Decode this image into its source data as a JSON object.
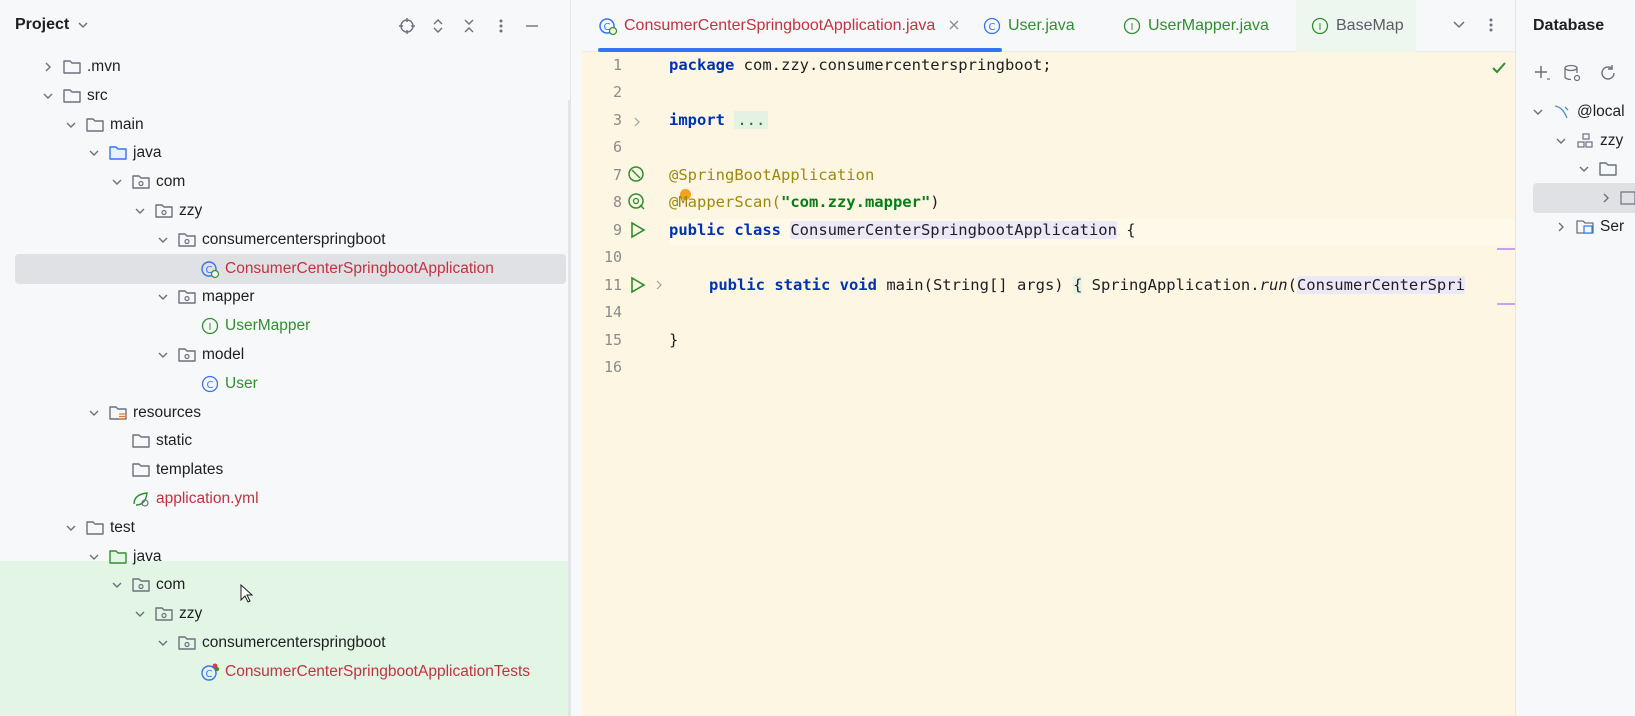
{
  "project": {
    "title": "Project",
    "tree": [
      {
        "label": ".mvn",
        "icon": "folder-icon",
        "expanded": false,
        "level": 0,
        "color": "normal"
      },
      {
        "label": "src",
        "icon": "folder-icon",
        "expanded": true,
        "level": 0,
        "color": "normal"
      },
      {
        "label": "main",
        "icon": "folder-icon",
        "expanded": true,
        "level": 1,
        "color": "normal"
      },
      {
        "label": "java",
        "icon": "source-folder-icon",
        "expanded": true,
        "level": 2,
        "color": "normal"
      },
      {
        "label": "com",
        "icon": "package-icon",
        "expanded": true,
        "level": 3,
        "color": "normal"
      },
      {
        "label": "zzy",
        "icon": "package-icon",
        "expanded": true,
        "level": 4,
        "color": "normal"
      },
      {
        "label": "consumercenterspringboot",
        "icon": "package-icon",
        "expanded": true,
        "level": 5,
        "color": "normal"
      },
      {
        "label": "ConsumerCenterSpringbootApplication",
        "icon": "spring-boot-class-icon",
        "expanded": null,
        "level": 6,
        "color": "red",
        "selected": true
      },
      {
        "label": "mapper",
        "icon": "package-icon",
        "expanded": true,
        "level": 5,
        "color": "normal"
      },
      {
        "label": "UserMapper",
        "icon": "interface-icon",
        "expanded": null,
        "level": 6,
        "color": "green"
      },
      {
        "label": "model",
        "icon": "package-icon",
        "expanded": true,
        "level": 5,
        "color": "normal"
      },
      {
        "label": "User",
        "icon": "class-icon",
        "expanded": null,
        "level": 6,
        "color": "green"
      },
      {
        "label": "resources",
        "icon": "resources-folder-icon",
        "expanded": true,
        "level": 2,
        "color": "normal"
      },
      {
        "label": "static",
        "icon": "folder-icon",
        "expanded": null,
        "level": 3,
        "color": "normal"
      },
      {
        "label": "templates",
        "icon": "folder-icon",
        "expanded": null,
        "level": 3,
        "color": "normal"
      },
      {
        "label": "application.yml",
        "icon": "spring-config-icon",
        "expanded": null,
        "level": 3,
        "color": "red"
      },
      {
        "label": "test",
        "icon": "folder-icon",
        "expanded": true,
        "level": 1,
        "color": "normal"
      },
      {
        "label": "java",
        "icon": "test-folder-icon",
        "expanded": true,
        "level": 2,
        "color": "normal"
      },
      {
        "label": "com",
        "icon": "package-icon",
        "expanded": true,
        "level": 3,
        "color": "normal"
      },
      {
        "label": "zzy",
        "icon": "package-icon",
        "expanded": true,
        "level": 4,
        "color": "normal"
      },
      {
        "label": "consumercenterspringboot",
        "icon": "package-icon",
        "expanded": true,
        "level": 5,
        "color": "normal"
      },
      {
        "label": "ConsumerCenterSpringbootApplicationTests",
        "icon": "test-class-icon",
        "expanded": null,
        "level": 6,
        "color": "red"
      }
    ]
  },
  "editor": {
    "tabs": [
      {
        "label": "ConsumerCenterSpringbootApplication.java",
        "icon": "spring-boot-class-icon",
        "active": true,
        "color": "red"
      },
      {
        "label": "User.java",
        "icon": "class-icon",
        "active": false,
        "color": "green"
      },
      {
        "label": "UserMapper.java",
        "icon": "interface-icon",
        "active": false,
        "color": "green"
      },
      {
        "label": "BaseMap",
        "icon": "interface-icon",
        "active": false,
        "color": "normal"
      }
    ],
    "line_numbers": [
      "1",
      "2",
      "3",
      "6",
      "7",
      "8",
      "9",
      "10",
      "11",
      "14",
      "15",
      "16"
    ],
    "code": {
      "l1_kw": "package",
      "l1_rest": " com.zzy.consumercenterspringboot;",
      "l3_kw": "import",
      "l3_dots": "...",
      "l7": "@SpringBootApplication",
      "l8_ann": "@MapperScan(",
      "l8_str": "\"com.zzy.mapper\"",
      "l8_end": ")",
      "l9_kw": "public class",
      "l9_name": "ConsumerCenterSpringbootApplication",
      "l9_end": " {",
      "l11_kw": "public static void",
      "l11_a": " main(String[] args) ",
      "l11_brace": "{",
      "l11_b": " SpringApplication.",
      "l11_run": "run",
      "l11_c": "(",
      "l11_arg": "ConsumerCenterSpri",
      "l15": "}"
    }
  },
  "database": {
    "title": "Database",
    "items": [
      {
        "label": "@local",
        "icon": "mysql-icon",
        "level": 0
      },
      {
        "label": "zzy",
        "icon": "schema-icon",
        "level": 1
      },
      {
        "label": "",
        "icon": "folder-icon",
        "level": 2
      },
      {
        "label": "",
        "icon": "table-icon",
        "level": 3
      },
      {
        "label": "Ser",
        "icon": "server-objects-icon",
        "level": 1
      }
    ]
  },
  "colors": {
    "accent": "#3574f0",
    "vcs_modified_red": "#c3323f",
    "vcs_added_green": "#2f8f2f",
    "editor_bg": "#fdf6e3"
  }
}
